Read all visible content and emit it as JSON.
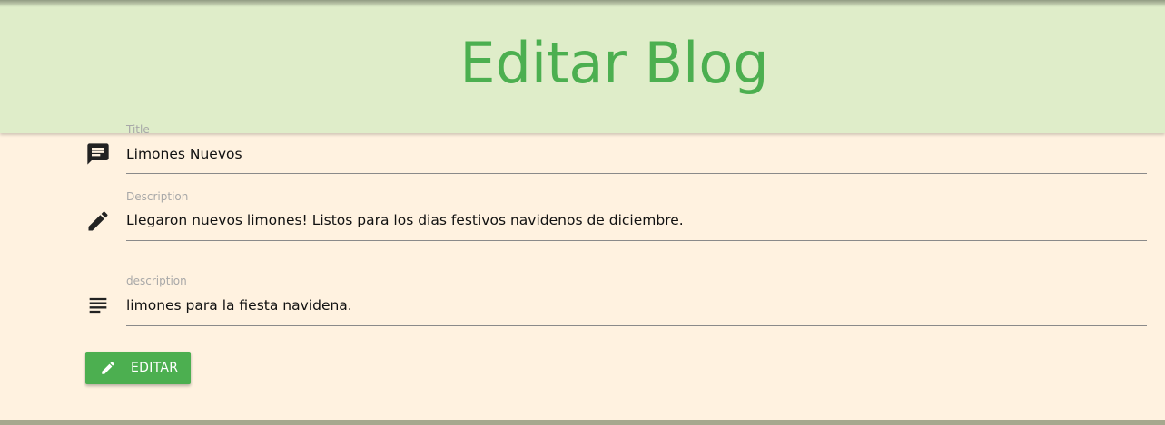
{
  "header": {
    "title": "Editar Blog"
  },
  "form": {
    "title_field": {
      "label": "Title",
      "value": "Limones Nuevos"
    },
    "description_field": {
      "label": "Description",
      "value": "Llegaron nuevos limones! Listos para los dias festivos navidenos de diciembre."
    },
    "content_field": {
      "label": "description",
      "value": "limones para la fiesta navidena."
    },
    "submit_button": {
      "label": "EDITAR"
    }
  },
  "colors": {
    "header_background": "#dfedc9",
    "page_background": "#fff2e0",
    "accent": "#4caf50"
  },
  "icons": {
    "title": "message-icon",
    "description": "pencil-icon",
    "content": "subject-icon",
    "button": "pencil-icon"
  }
}
